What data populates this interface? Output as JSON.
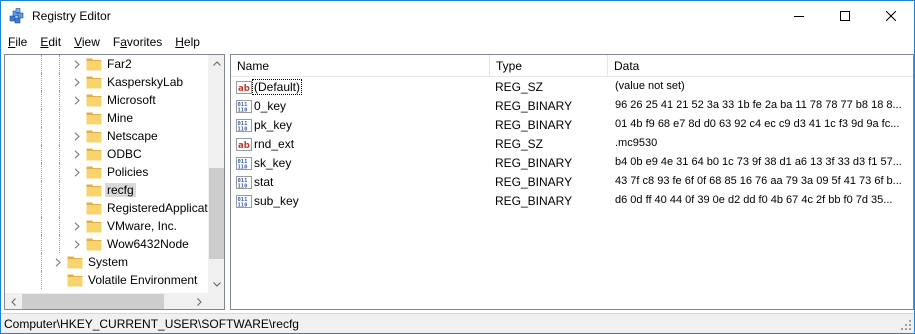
{
  "window": {
    "title": "Registry Editor"
  },
  "titlebar": {
    "minimize": "minimize",
    "maximize": "maximize",
    "close": "close"
  },
  "menu": [
    {
      "label": "File",
      "underline": "F",
      "rest": "ile"
    },
    {
      "label": "Edit",
      "underline": "E",
      "rest": "dit"
    },
    {
      "label": "View",
      "underline": "V",
      "rest": "iew"
    },
    {
      "label": "Favorites",
      "underline": "a",
      "pre": "F",
      "rest": "vorites"
    },
    {
      "label": "Help",
      "underline": "H",
      "rest": "elp"
    }
  ],
  "tree": {
    "items": [
      {
        "label": "Far2",
        "expandable": true,
        "selected": false
      },
      {
        "label": "KasperskyLab",
        "expandable": true,
        "selected": false
      },
      {
        "label": "Microsoft",
        "expandable": true,
        "selected": false
      },
      {
        "label": "Mine",
        "expandable": false,
        "selected": false
      },
      {
        "label": "Netscape",
        "expandable": true,
        "selected": false
      },
      {
        "label": "ODBC",
        "expandable": true,
        "selected": false
      },
      {
        "label": "Policies",
        "expandable": true,
        "selected": false
      },
      {
        "label": "recfg",
        "expandable": false,
        "selected": true
      },
      {
        "label": "RegisteredApplicati",
        "expandable": false,
        "selected": false
      },
      {
        "label": "VMware, Inc.",
        "expandable": true,
        "selected": false
      },
      {
        "label": "Wow6432Node",
        "expandable": true,
        "selected": false
      },
      {
        "label": "System",
        "expandable": true,
        "selected": false
      },
      {
        "label": "Volatile Environment",
        "expandable": false,
        "selected": false
      }
    ]
  },
  "values": {
    "columns": {
      "name": "Name",
      "type": "Type",
      "data": "Data"
    },
    "rows": [
      {
        "icon": "string-value-icon",
        "name": "(Default)",
        "type": "REG_SZ",
        "data": "(value not set)",
        "focused": true
      },
      {
        "icon": "binary-value-icon",
        "name": "0_key",
        "type": "REG_BINARY",
        "data": "96 26 25 41 21 52 3a 33 1b fe 2a ba 11 78 78 77 b8 18 8...",
        "focused": false
      },
      {
        "icon": "binary-value-icon",
        "name": "pk_key",
        "type": "REG_BINARY",
        "data": "01 4b f9 68 e7 8d d0 63 92 c4 ec c9 d3 41 1c f3 9d 9a fc...",
        "focused": false
      },
      {
        "icon": "string-value-icon",
        "name": "rnd_ext",
        "type": "REG_SZ",
        "data": ".mc9530",
        "focused": false
      },
      {
        "icon": "binary-value-icon",
        "name": "sk_key",
        "type": "REG_BINARY",
        "data": "b4 0b e9 4e 31 64 b0 1c 73 9f 38 d1 a6 13 3f 33 d3 f1 57...",
        "focused": false
      },
      {
        "icon": "binary-value-icon",
        "name": "stat",
        "type": "REG_BINARY",
        "data": "43 7f c8 93 fe 6f 0f 68 85 16 76 aa 79 3a 09 5f 41 73 6f b...",
        "focused": false
      },
      {
        "icon": "binary-value-icon",
        "name": "sub_key",
        "type": "REG_BINARY",
        "data": "d6 0d ff 40 44 0f 39 0e d2 dd f0 4b 67 4c 2f bb f0 7d 35...",
        "focused": false
      }
    ]
  },
  "status": {
    "path": "Computer\\HKEY_CURRENT_USER\\SOFTWARE\\recfg"
  },
  "colors": {
    "accent": "#1883d7",
    "folder": "#f7d46e",
    "folder_dark": "#e0b040",
    "selection": "#d9d9d9",
    "binary_icon": "#2f5fb3",
    "string_icon": "#c0392b"
  }
}
